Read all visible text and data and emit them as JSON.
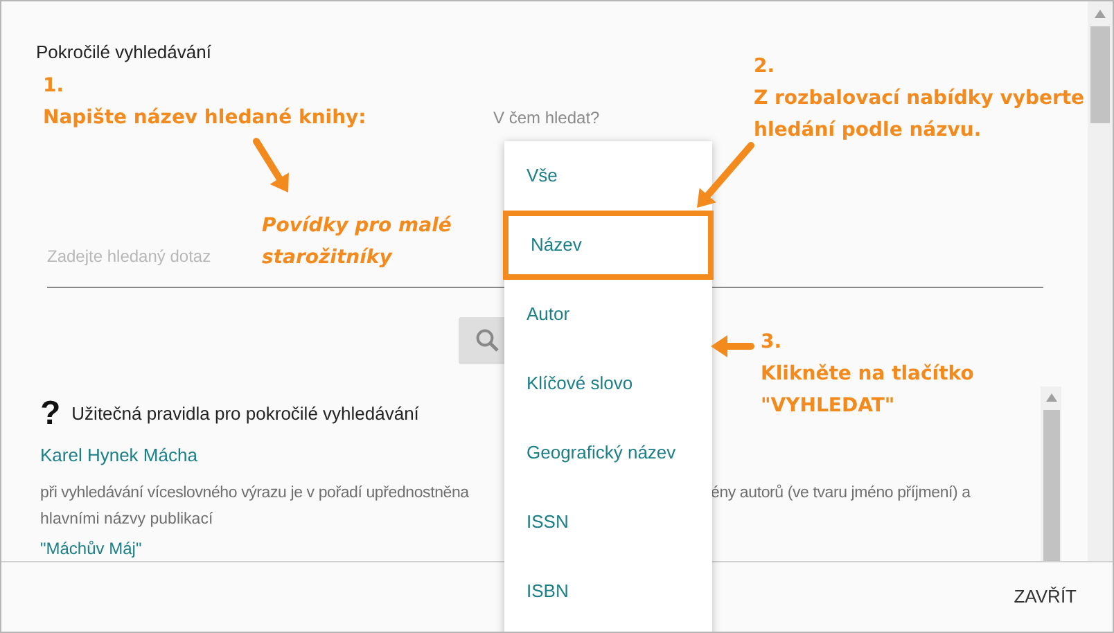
{
  "dialog": {
    "title": "Pokročilé vyhledávání",
    "search_in_label": "V čem hledat?",
    "search_field": {
      "placeholder": "Zadejte hledaný dotaz"
    },
    "help": {
      "icon_text": "?",
      "heading": "Užitečná pravidla pro pokročilé vyhledávání",
      "example_link": "Karel Hynek Mácha",
      "text_left": "při vyhledávání víceslovného výrazu je v pořadí upřednostněna",
      "text_right": "ény autorů (ve tvaru jméno příjmení) a",
      "text_line_2": "hlavními názvy publikací",
      "next_example": "\"Máchův Máj\""
    },
    "close_button": "ZAVŘÍT"
  },
  "dropdown": [
    {
      "label": "Vše",
      "selected": false
    },
    {
      "label": "Název",
      "selected": true
    },
    {
      "label": "Autor",
      "selected": false
    },
    {
      "label": "Klíčové slovo",
      "selected": false
    },
    {
      "label": "Geografický název",
      "selected": false
    },
    {
      "label": "ISSN",
      "selected": false
    },
    {
      "label": "ISBN",
      "selected": false
    }
  ],
  "annotations": [
    {
      "kind": "step",
      "number": "1.",
      "lines": [
        "Napište název hledané knihy:"
      ]
    },
    {
      "kind": "example",
      "lines": [
        "Povídky pro malé",
        "starožitníky"
      ]
    },
    {
      "kind": "step",
      "number": "2.",
      "lines": [
        "Z rozbalovací nabídky vyberte",
        "hledání podle názvu."
      ]
    },
    {
      "kind": "step",
      "number": "3.",
      "lines": [
        "Klikněte na tlačítko",
        "\"VYHLEDAT\""
      ]
    }
  ]
}
